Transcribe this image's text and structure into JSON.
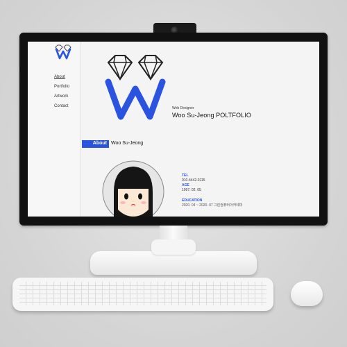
{
  "sidebar": {
    "items": [
      {
        "label": "About"
      },
      {
        "label": "Portfolio"
      },
      {
        "label": "Artwork"
      },
      {
        "label": "Contact"
      }
    ]
  },
  "hero": {
    "subtitle": "Web Designer",
    "title": "Woo Su-Jeong POLTFOLIO"
  },
  "about": {
    "heading": "About",
    "name": "Woo Su-Jeong"
  },
  "info": {
    "tel_label": "TEL",
    "tel_value": "010-4442-0115",
    "age_label": "AGE",
    "age_value": "1997. 02. 05",
    "education_label": "EDUCATION",
    "education_value": "2020. 04 ~ 2020. 07 그린컴퓨터아카데미"
  },
  "colors": {
    "accent": "#2a54e0",
    "bezel": "#111111",
    "screen": "#f4f4f4"
  }
}
